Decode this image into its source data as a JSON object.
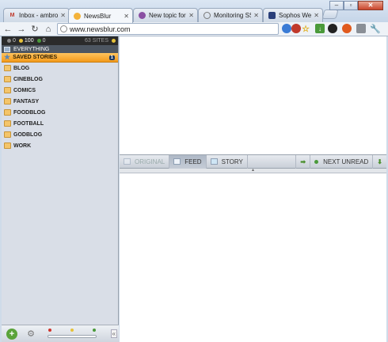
{
  "tabs": [
    {
      "title": "Inbox - ambrosi",
      "icon": "gmail-icon",
      "active": false
    },
    {
      "title": "NewsBlur",
      "icon": "newsblur-icon",
      "active": true
    },
    {
      "title": "New topic for N",
      "icon": "getsatisfaction-icon",
      "active": false
    },
    {
      "title": "Monitoring SSRS",
      "icon": "web-icon",
      "active": false
    },
    {
      "title": "Sophos Web Ap",
      "icon": "sophos-icon",
      "active": false
    }
  ],
  "address": {
    "url": "www.newsblur.com"
  },
  "counts": {
    "neutral": "0",
    "positive": "100",
    "negative": "0",
    "sites": "63 SITES"
  },
  "sidebar": {
    "everything_label": "EVERYTHING",
    "saved_label": "SAVED STORIES",
    "saved_count": "1",
    "folders": [
      "BLOG",
      "CINEBLOG",
      "COMICS",
      "FANTASY",
      "FOODBLOG",
      "FOOTBALL",
      "GODBLOG",
      "WORK"
    ]
  },
  "taskbar": {
    "original": "ORIGINAL",
    "feed": "FEED",
    "story": "STORY",
    "next_unread": "NEXT UNREAD"
  },
  "colors": {
    "saved_bg": "#f7a523",
    "counts_bg": "#2b2b2b",
    "sidebar_bg": "#d9dee7"
  }
}
